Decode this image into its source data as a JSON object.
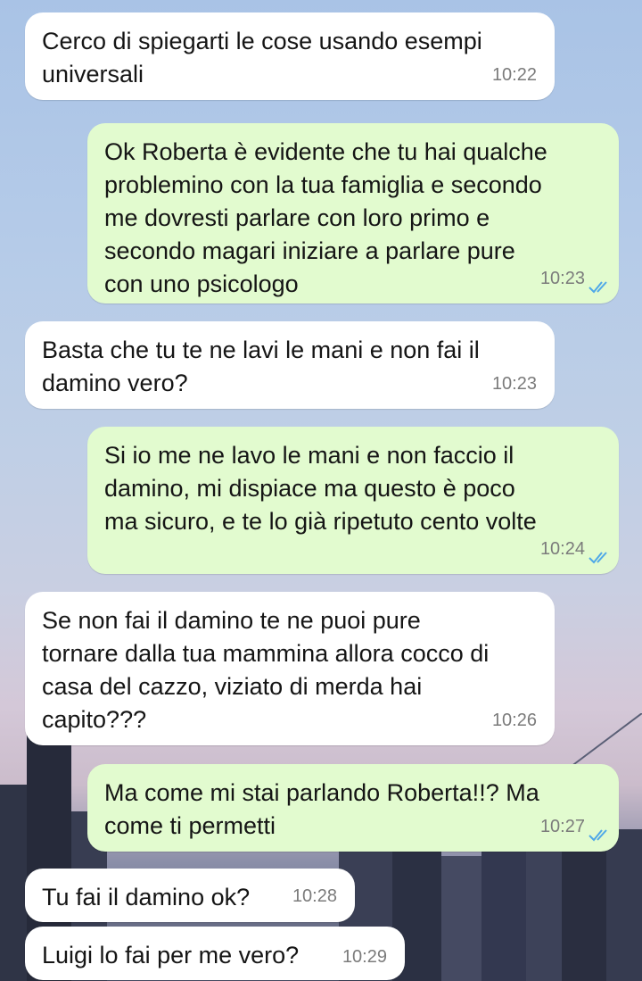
{
  "colors": {
    "incoming_bubble": "#ffffff",
    "outgoing_bubble": "#e2fbcf",
    "read_ticks": "#4fa8e8",
    "timestamp": "#7b7b7b"
  },
  "messages": [
    {
      "direction": "in",
      "text": "Cerco di spiegarti le cose usando esempi\nuniversali",
      "time": "10:22"
    },
    {
      "direction": "out",
      "text": "Ok Roberta è evidente che tu hai qualche\nproblemino con la tua famiglia e secondo\nme dovresti parlare con loro primo e\nsecondo magari iniziare a parlare pure\ncon uno psicologo",
      "time": "10:23",
      "status": "read"
    },
    {
      "direction": "in",
      "text": "Basta che tu te ne lavi le mani e non fai il\ndamino vero?",
      "time": "10:23"
    },
    {
      "direction": "out",
      "text": "Si io me ne lavo le mani e non faccio il\ndamino, mi dispiace ma questo è poco\nma sicuro, e te lo già ripetuto cento volte",
      "time": "10:24",
      "status": "read"
    },
    {
      "direction": "in",
      "text": "Se non fai il damino te ne puoi pure\ntornare dalla tua mammina allora cocco di\ncasa del cazzo, viziato di merda hai\ncapito???",
      "time": "10:26"
    },
    {
      "direction": "out",
      "text": "Ma come mi stai parlando Roberta!!? Ma\ncome ti permetti",
      "time": "10:27",
      "status": "read"
    },
    {
      "direction": "in",
      "text": "Tu fai il damino ok?",
      "time": "10:28"
    },
    {
      "direction": "in",
      "text": "Luigi lo fai per me vero?",
      "time": "10:29"
    }
  ]
}
